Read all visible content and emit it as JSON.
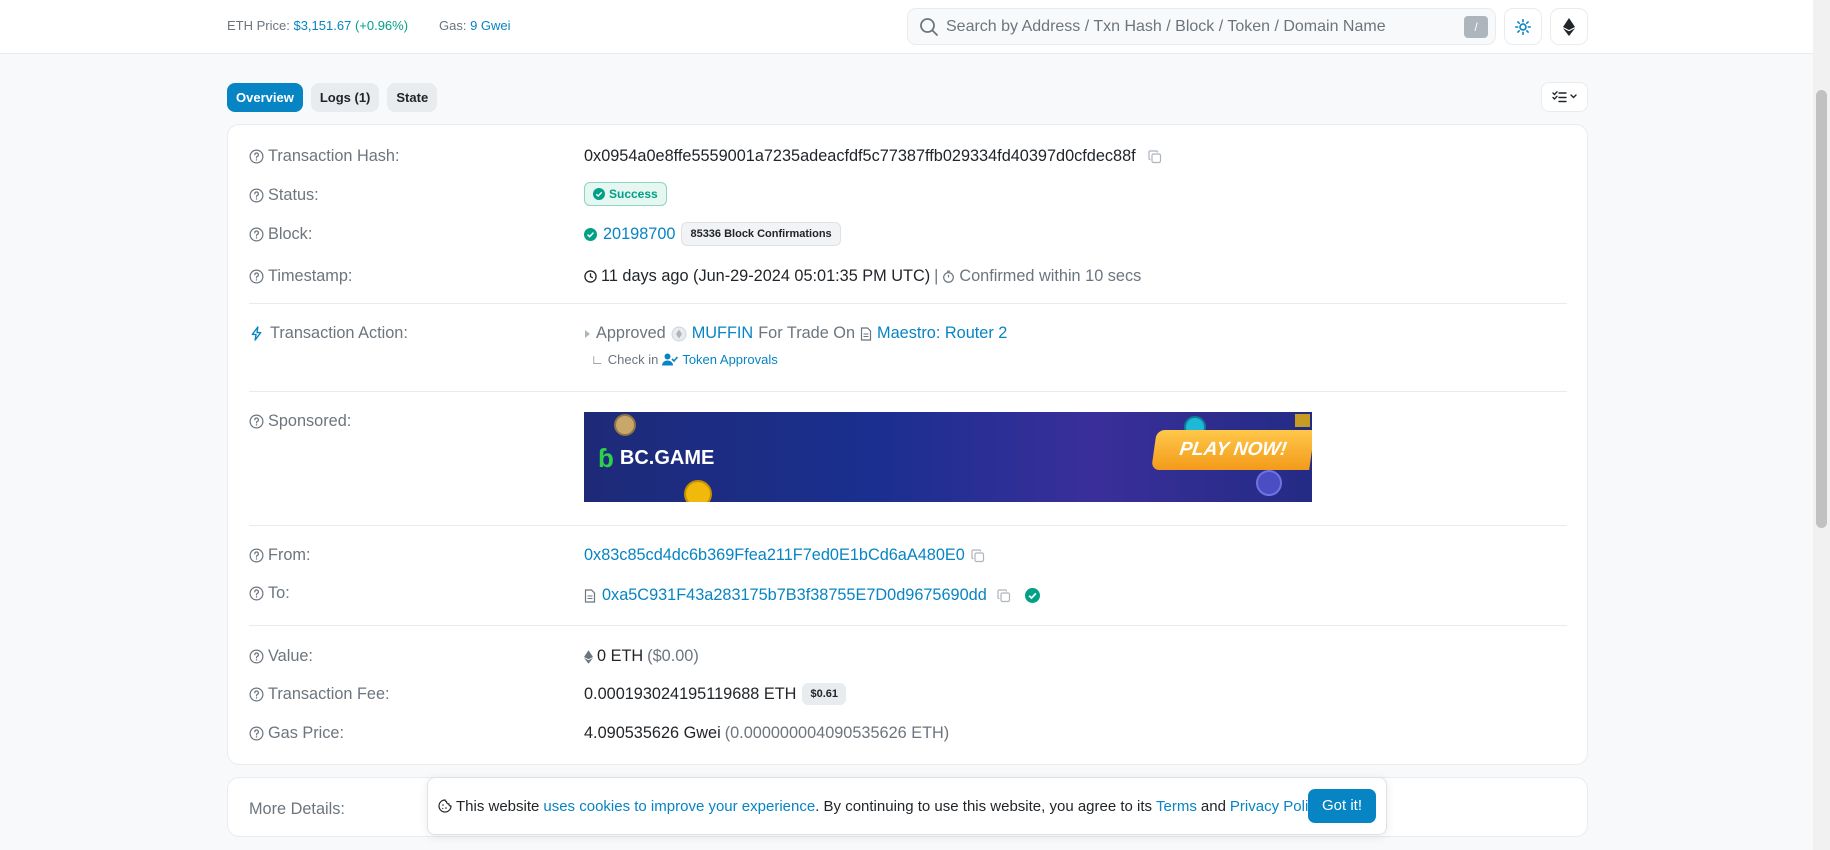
{
  "header": {
    "eth_price_label": "ETH Price:",
    "eth_price_value": "$3,151.67",
    "eth_price_change": "(+0.96%)",
    "gas_label": "Gas:",
    "gas_value": "9 Gwei",
    "search_placeholder": "Search by Address / Txn Hash / Block / Token / Domain Name",
    "search_shortcut": "/"
  },
  "tabs": [
    {
      "label": "Overview",
      "active": true
    },
    {
      "label": "Logs (1)",
      "active": false
    },
    {
      "label": "State",
      "active": false
    }
  ],
  "details": {
    "tx_hash_label": "Transaction Hash:",
    "tx_hash": "0x0954a0e8ffe5559001a7235adeacfdf5c77387ffb029334fd40397d0cfdec88f",
    "status_label": "Status:",
    "status": "Success",
    "block_label": "Block:",
    "block": "20198700",
    "block_confirmations": "85336 Block Confirmations",
    "timestamp_label": "Timestamp:",
    "timestamp": "11 days ago (Jun-29-2024 05:01:35 PM UTC)",
    "timestamp_sep": "|",
    "confirmed_within": "Confirmed within 10 secs",
    "action_label": "Transaction Action:",
    "action_approved": "Approved",
    "action_token": "MUFFIN",
    "action_for_trade_on": "For Trade On",
    "action_router": "Maestro: Router 2",
    "action_check_in": "Check in",
    "action_token_approvals": "Token Approvals",
    "sponsored_label": "Sponsored:",
    "ad_brand": "BC.GAME",
    "ad_cta": "PLAY NOW!",
    "from_label": "From:",
    "from": "0x83c85cd4dc6b369Ffea211F7ed0E1bCd6aA480E0",
    "to_label": "To:",
    "to": "0xa5C931F43a283175b7B3f38755E7D0d9675690dd",
    "value_label": "Value:",
    "value": "0 ETH",
    "value_usd": "($0.00)",
    "fee_label": "Transaction Fee:",
    "fee": "0.000193024195119688 ETH",
    "fee_usd": "$0.61",
    "gas_price_label": "Gas Price:",
    "gas_price": "4.090535626 Gwei",
    "gas_price_eth": "(0.000000004090535626 ETH)"
  },
  "more_details_label": "More Details:",
  "cookie": {
    "text1": "This website",
    "link1": "uses cookies to improve your experience",
    "text2": ". By continuing to use this website, you agree to its",
    "terms": "Terms",
    "and": "and",
    "privacy": "Privacy Policy",
    "period": ".",
    "button": "Got it!"
  },
  "colors": {
    "accent": "#0784c3",
    "success": "#00a186"
  }
}
